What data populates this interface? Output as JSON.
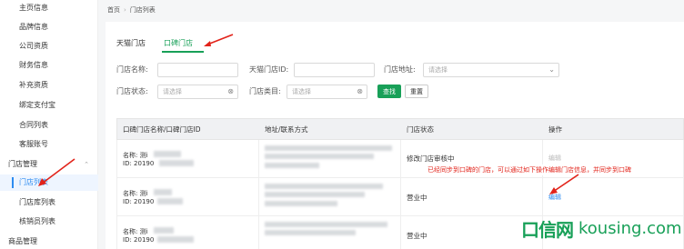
{
  "sidebar": {
    "items": [
      {
        "label": "主页信息",
        "type": "sub"
      },
      {
        "label": "品牌信息",
        "type": "sub"
      },
      {
        "label": "公司资质",
        "type": "sub"
      },
      {
        "label": "财务信息",
        "type": "sub"
      },
      {
        "label": "补充资质",
        "type": "sub"
      },
      {
        "label": "绑定支付宝",
        "type": "sub"
      },
      {
        "label": "合同列表",
        "type": "sub"
      },
      {
        "label": "客服账号",
        "type": "sub"
      },
      {
        "label": "门店管理",
        "type": "group"
      },
      {
        "label": "门店列表",
        "type": "sub",
        "active": true
      },
      {
        "label": "门店库列表",
        "type": "sub"
      },
      {
        "label": "核销员列表",
        "type": "sub"
      },
      {
        "label": "商品管理",
        "type": "group"
      }
    ]
  },
  "breadcrumb": {
    "home": "首页",
    "current": "门店列表"
  },
  "tabs": [
    {
      "label": "天猫门店",
      "active": false
    },
    {
      "label": "口碑门店",
      "active": true
    }
  ],
  "filters": {
    "store_name_label": "门店名称:",
    "tmall_id_label": "天猫门店ID:",
    "address_label": "门店地址:",
    "address_placeholder": "请选择",
    "status_label": "门店状态:",
    "status_placeholder": "请选择",
    "category_label": "门店类目:",
    "category_placeholder": "请选择",
    "search_label": "查找",
    "reset_label": "重置"
  },
  "table": {
    "headers": [
      "口碑门店名称/口碑门店ID",
      "地址/联系方式",
      "门店状态",
      "操作"
    ],
    "rows": [
      {
        "name_prefix": "名称: 测i",
        "id_prefix": "ID:    20190",
        "status": "修改门店审核中",
        "action": "编辑",
        "action_enabled": false
      },
      {
        "name_prefix": "名称: 测i",
        "id_prefix": "ID: 20190",
        "status": "营业中",
        "action": "编辑",
        "action_enabled": true
      },
      {
        "name_prefix": "名称: 测i",
        "id_prefix": "ID: 20190",
        "status": "营业中",
        "action": "",
        "action_enabled": false
      }
    ]
  },
  "annotation": {
    "note": "已经同步到口碑的门店，可以通过如下操作编辑门店信息，并同步到口碑"
  },
  "watermark": {
    "logo": "口信网",
    "domain": "kousing.com"
  },
  "colors": {
    "accent": "#18a058",
    "link": "#2d8cf0",
    "annotation": "#e2231a"
  }
}
